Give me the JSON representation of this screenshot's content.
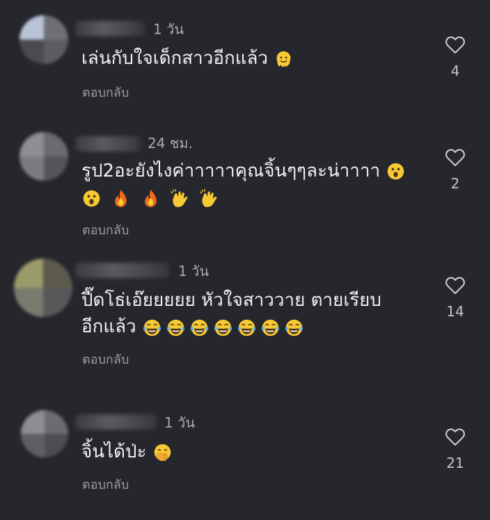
{
  "comments": [
    {
      "time": "1 วัน",
      "text": "เล่นกับใจเด็กสาวอีกแล้ว",
      "emojis": [
        "melting-face"
      ],
      "reply": "ตอบกลับ",
      "likes": "4",
      "avatar_colors": [
        "#b9c3d6",
        "#6e7076",
        "#4a4b4f",
        "#5c5d62"
      ]
    },
    {
      "time": "24 ชม.",
      "text": "รูป2อะยังไงค่าาาาาคุณจิ้นๆๆละน่าาาา",
      "emojis_inline": [
        "surprised-face"
      ],
      "emojis": [
        "surprised-face",
        "fire",
        "fire",
        "clapping-hands",
        "clapping-hands"
      ],
      "reply": "ตอบกลับ",
      "likes": "2",
      "avatar_colors": [
        "#8e8f94",
        "#6a6b70",
        "#7b7c81",
        "#55565b"
      ]
    },
    {
      "time": "1 วัน",
      "text": "ปี๊ดโธ่เอ๊ยยยยย หัวใจสาววาย ตายเรียบ",
      "text2": "อีกแล้ว",
      "emojis": [
        "tears-of-joy",
        "tears-of-joy",
        "tears-of-joy",
        "tears-of-joy",
        "tears-of-joy",
        "tears-of-joy",
        "tears-of-joy"
      ],
      "reply": "ตอบกลับ",
      "likes": "14",
      "avatar_colors": [
        "#9a9a6a",
        "#5c5a4c",
        "#7a7b6e",
        "#575859"
      ]
    },
    {
      "time": "1 วัน",
      "text": "จิ้นได้ป่ะ",
      "emojis": [
        "hand-over-mouth"
      ],
      "reply": "ตอบกลับ",
      "likes": "21",
      "avatar_colors": [
        "#8d8e93",
        "#6b6c71",
        "#5e5f64",
        "#4d4e53"
      ]
    }
  ]
}
